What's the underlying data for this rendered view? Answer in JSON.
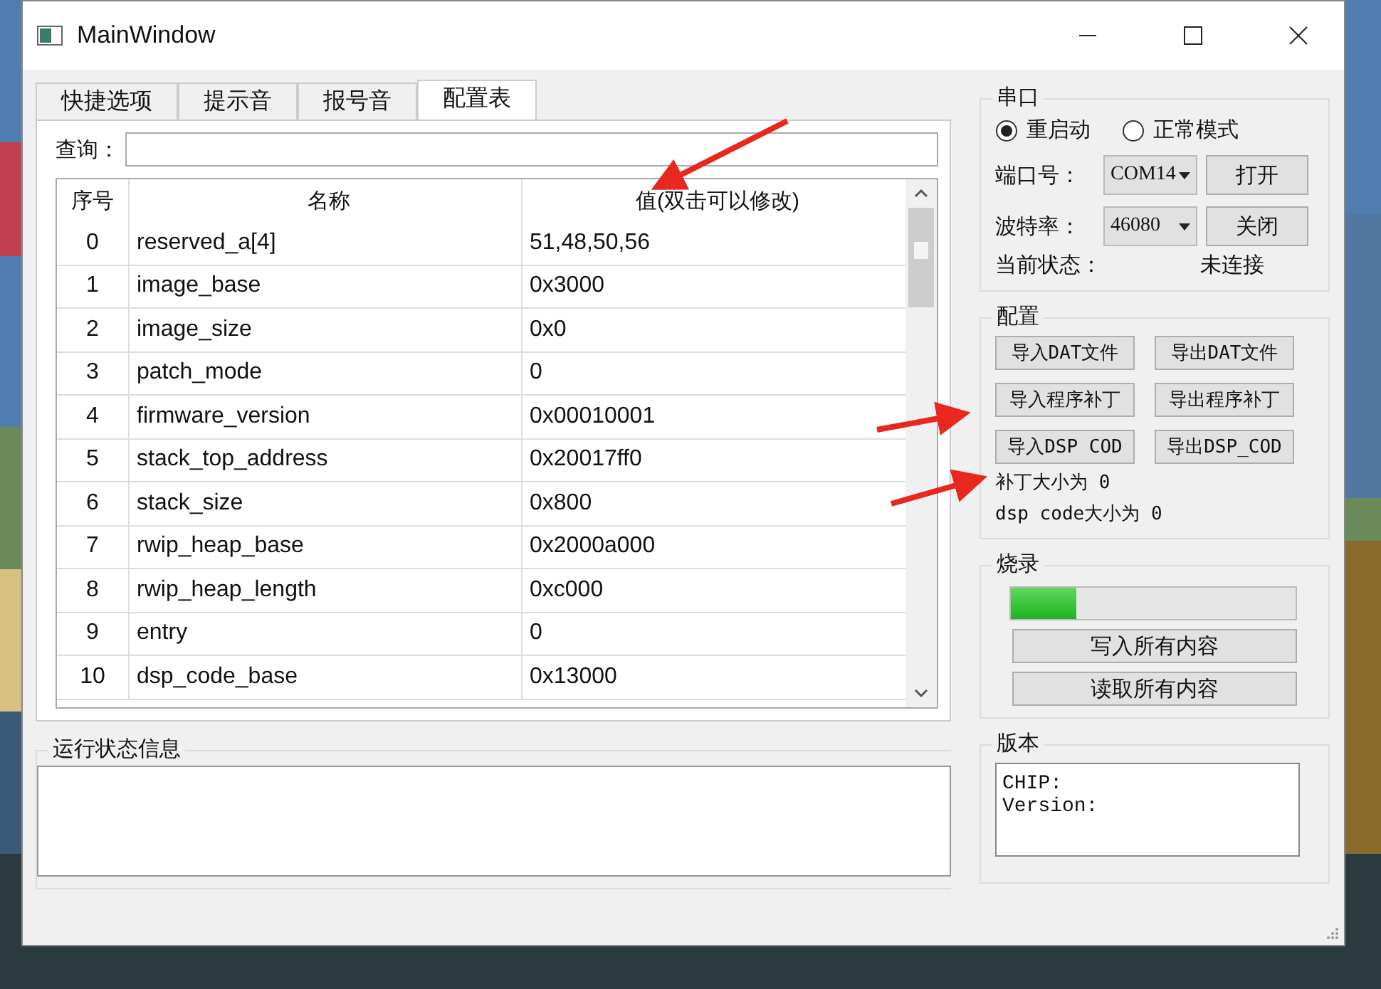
{
  "window": {
    "title": "MainWindow"
  },
  "tabs": [
    {
      "label": "快捷选项",
      "selected": false
    },
    {
      "label": "提示音",
      "selected": false
    },
    {
      "label": "报号音",
      "selected": false
    },
    {
      "label": "配置表",
      "selected": true
    }
  ],
  "query": {
    "label": "查询："
  },
  "table": {
    "columns": [
      "序号",
      "名称",
      "值(双击可以修改)"
    ],
    "rows": [
      [
        "0",
        "reserved_a[4]",
        "51,48,50,56"
      ],
      [
        "1",
        "image_base",
        "0x3000"
      ],
      [
        "2",
        "image_size",
        "0x0"
      ],
      [
        "3",
        "patch_mode",
        "0"
      ],
      [
        "4",
        "firmware_version",
        "0x00010001"
      ],
      [
        "5",
        "stack_top_address",
        "0x20017ff0"
      ],
      [
        "6",
        "stack_size",
        "0x800"
      ],
      [
        "7",
        "rwip_heap_base",
        "0x2000a000"
      ],
      [
        "8",
        "rwip_heap_length",
        "0xc000"
      ],
      [
        "9",
        "entry",
        "0"
      ],
      [
        "10",
        "dsp_code_base",
        "0x13000"
      ]
    ]
  },
  "log": {
    "title": "运行状态信息"
  },
  "serial": {
    "title": "串口",
    "modes": [
      {
        "label": "重启动",
        "selected": true
      },
      {
        "label": "正常模式",
        "selected": false
      }
    ],
    "port_label": "端口号：",
    "port": "COM14",
    "open": "打开",
    "baud_label": "波特率：",
    "baud": "46080",
    "close": "关闭",
    "status_label": "当前状态：",
    "status": "未连接"
  },
  "config": {
    "title": "配置",
    "buttons": [
      "导入DAT文件",
      "导出DAT文件",
      "导入程序补丁",
      "导出程序补丁",
      "导入DSP COD",
      "导出DSP_COD"
    ],
    "info": [
      "补丁大小为 0",
      "dsp code大小为 0"
    ]
  },
  "burn": {
    "title": "烧录",
    "level": 0.23,
    "buttons": [
      "写入所有内容",
      "读取所有内容"
    ]
  },
  "version": {
    "title": "版本",
    "lines": [
      "CHIP:",
      "Version:"
    ]
  }
}
